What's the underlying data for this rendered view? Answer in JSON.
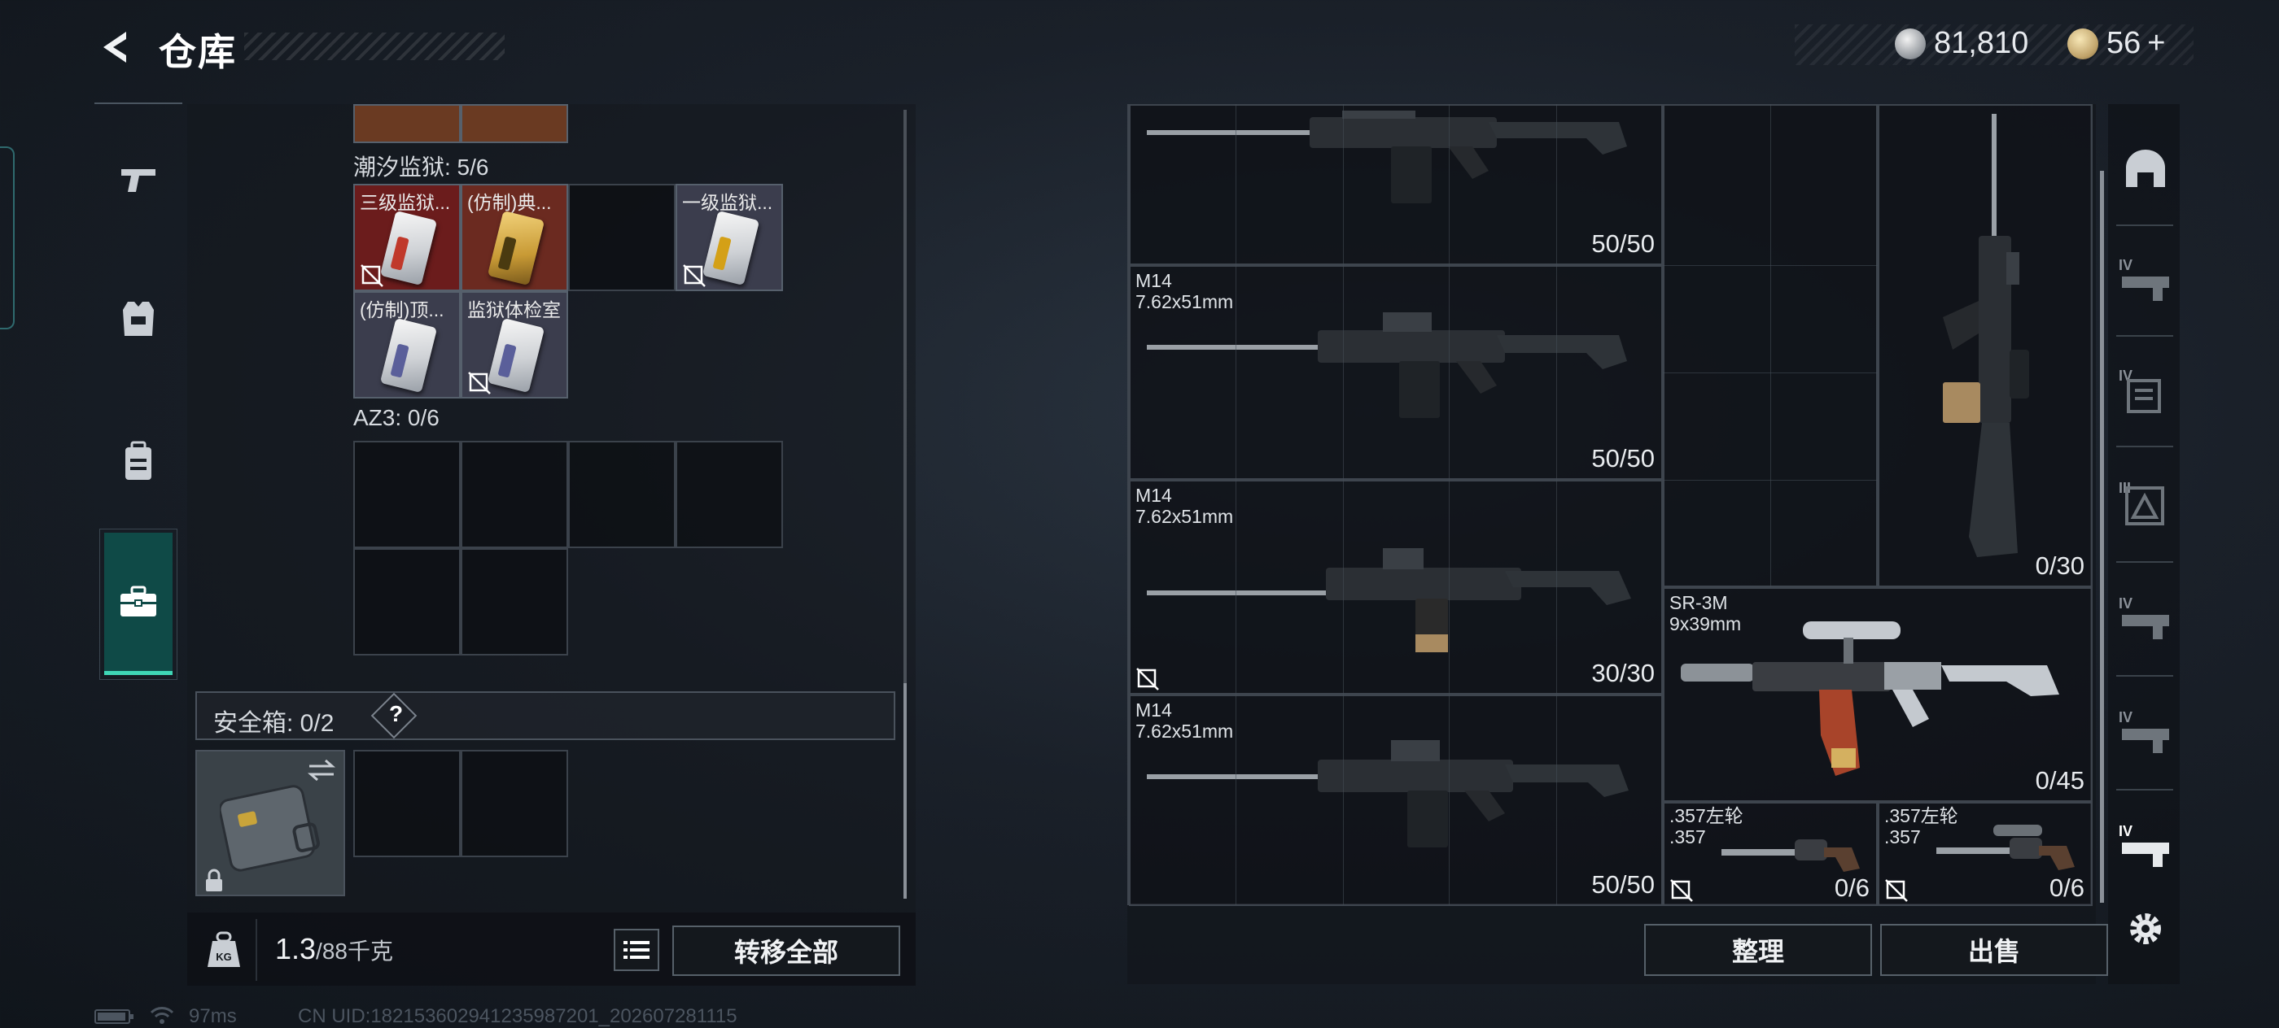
{
  "header": {
    "title": "仓库",
    "currency_silver": "81,810",
    "currency_gold": "56",
    "currency_plus": "+"
  },
  "left": {
    "section1_label": "潮汐监狱: 5/6",
    "cards_row1": [
      "三级监狱...",
      "(仿制)典...",
      "",
      "一级监狱..."
    ],
    "cards_row2": [
      "(仿制)顶...",
      "监狱体检室"
    ],
    "section2_label": "AZ3: 0/6",
    "safe_label": "安全箱: 0/2",
    "safe_help": "?",
    "weight_value": "1.3",
    "weight_max": "/88千克",
    "transfer_all": "转移全部",
    "kg_icon_text": "KG"
  },
  "right": {
    "weapons": [
      {
        "name": "",
        "caliber": "",
        "count": "50/50"
      },
      {
        "name": "M14",
        "caliber": "7.62x51mm",
        "count": "50/50"
      },
      {
        "name": "M14",
        "caliber": "7.62x51mm",
        "count": "30/30"
      },
      {
        "name": "M14",
        "caliber": "7.62x51mm",
        "count": "50/50"
      }
    ],
    "tall": {
      "count": "0/30"
    },
    "sr3m": {
      "name": "SR-3M",
      "caliber": "9x39mm",
      "count": "0/45"
    },
    "rev1": {
      "name": ".357左轮",
      "caliber": ".357",
      "count": "0/6"
    },
    "rev2": {
      "name": ".357左轮",
      "caliber": ".357",
      "count": "0/6"
    },
    "sort_button": "整理",
    "sell_button": "出售"
  },
  "rail": {
    "tiers": [
      "IV",
      "IV",
      "III",
      "IV",
      "IV",
      "IV"
    ]
  },
  "status": {
    "ping": "97ms",
    "uid": "CN UID:18215360294123598720​1_202607281115"
  },
  "colors": {
    "accent": "#3fd6b5",
    "active_tab": "#0f4a47",
    "card_red": "#6b1c1c",
    "card_grey": "#3b3d4d"
  }
}
